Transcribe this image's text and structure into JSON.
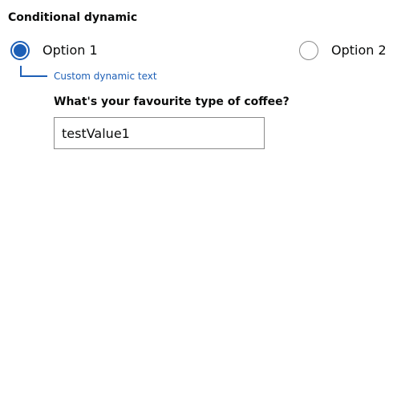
{
  "form": {
    "legend": "Conditional dynamic",
    "options": [
      {
        "label": "Option 1",
        "checked": true
      },
      {
        "label": "Option 2",
        "checked": false
      }
    ],
    "dynamic_text": "Custom dynamic text",
    "question": "What's your favourite type of coffee?",
    "coffee_input": {
      "value": "testValue1"
    }
  },
  "colors": {
    "accent": "#1d5fb6",
    "text": "#0b0c0c",
    "border": "#8a8a8a"
  }
}
